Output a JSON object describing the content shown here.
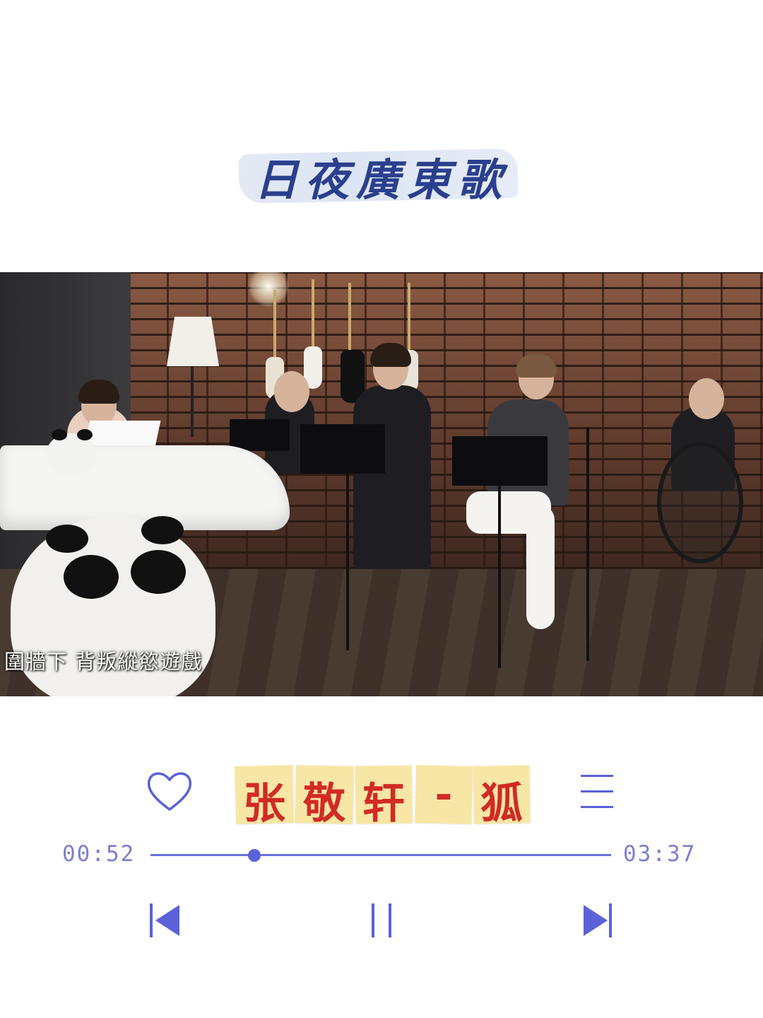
{
  "header": {
    "title": "日夜廣東歌"
  },
  "video": {
    "subtitle": "圍牆下  背叛縱慾遊戲"
  },
  "player": {
    "song_chars": [
      "张",
      "敬",
      "轩",
      "-",
      "狐"
    ],
    "time_elapsed": "00:52",
    "time_total": "03:37",
    "progress": 0.226,
    "accent_color": "#5b62d8"
  },
  "icons": {
    "like": "heart-icon",
    "playlist": "menu-icon",
    "previous": "previous-icon",
    "pause": "pause-icon",
    "next": "next-icon"
  }
}
